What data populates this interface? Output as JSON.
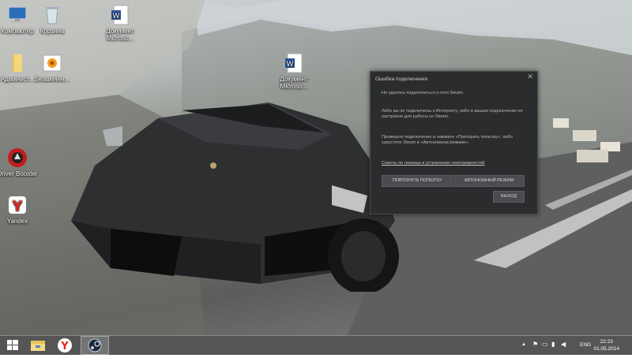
{
  "desktop": {
    "icons": [
      {
        "label": "Компьютер",
        "icon": "computer-icon"
      },
      {
        "label": "Корзина",
        "icon": "recycle-bin-icon"
      },
      {
        "label": "Документ Microso...",
        "icon": "word-document-icon"
      },
      {
        "label": "Админист...",
        "icon": "folder-icon"
      },
      {
        "label": "Безымянн...",
        "icon": "flower-image-icon"
      },
      {
        "label": "Документ Microso...",
        "icon": "word-document-icon"
      },
      {
        "label": "Driver Booster",
        "icon": "driver-booster-icon"
      },
      {
        "label": "Yandex",
        "icon": "yandex-browser-icon"
      }
    ]
  },
  "dialog": {
    "title": "Ошибка подключения",
    "line1": "Не удалось подключиться к сети Steam.",
    "line2": "Либо вы не подключены к Интернету, либо в вашем подключение не настроено для работы со Steam.",
    "line3": "Проверьте подключение и нажмите «Повторить попытку», либо запустите Steam в «Автономном режиме».",
    "help_link": "Советы по помощи и устранению неисправностей",
    "retry_button": "ПОВТОРИТЬ ПОПЫТКУ",
    "offline_button": "АВТОНОМНЫЙ РЕЖИМ",
    "exit_button": "ВЫХОД",
    "close_glyph": "✕"
  },
  "taskbar": {
    "language": "ENG",
    "time": "22:23",
    "date": "01.05.2014"
  }
}
